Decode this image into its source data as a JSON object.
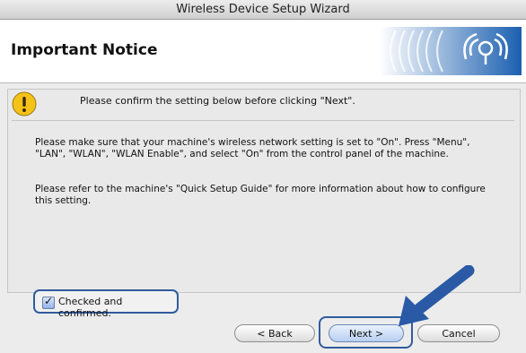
{
  "window": {
    "title": "Wireless Device Setup Wizard"
  },
  "header": {
    "title": "Important Notice"
  },
  "notice": {
    "text": "Please confirm the setting below before clicking \"Next\"."
  },
  "body": {
    "paragraph1": "Please make sure that your machine's wireless network setting is set to \"On\". Press \"Menu\", \"LAN\", \"WLAN\", \"WLAN Enable\", and select \"On\" from the control panel of the machine.",
    "paragraph2": "Please refer to the machine's \"Quick Setup Guide\" for more information about how to configure this setting."
  },
  "checkbox": {
    "label": "Checked and confirmed.",
    "checked": true
  },
  "buttons": {
    "back": "< Back",
    "next": "Next >",
    "cancel": "Cancel"
  },
  "colors": {
    "highlight": "#2f5c9e",
    "arrow": "#2a5aa6",
    "warning": "#f5c21a"
  }
}
